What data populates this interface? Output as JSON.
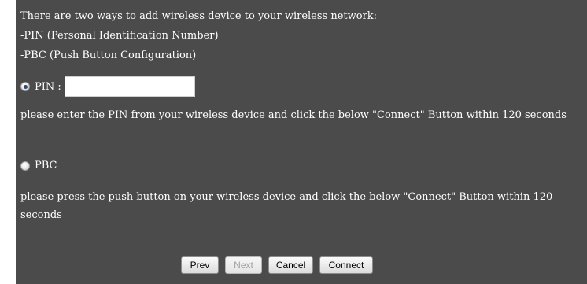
{
  "intro": {
    "line1": "There are two ways to add wireless device to your wireless network:",
    "line2": "-PIN (Personal Identification Number)",
    "line3": "-PBC (Push Button Configuration)"
  },
  "pin_option": {
    "label": "PIN :",
    "selected": true,
    "input_value": "",
    "description": "please enter the PIN from your wireless device and click the below \"Connect\" Button within 120 seconds"
  },
  "pbc_option": {
    "label": "PBC",
    "selected": false,
    "description": "please press the push button on your wireless device and click the below \"Connect\" Button within 120 seconds"
  },
  "buttons": {
    "prev": "Prev",
    "next": "Next",
    "cancel": "Cancel",
    "connect": "Connect"
  }
}
